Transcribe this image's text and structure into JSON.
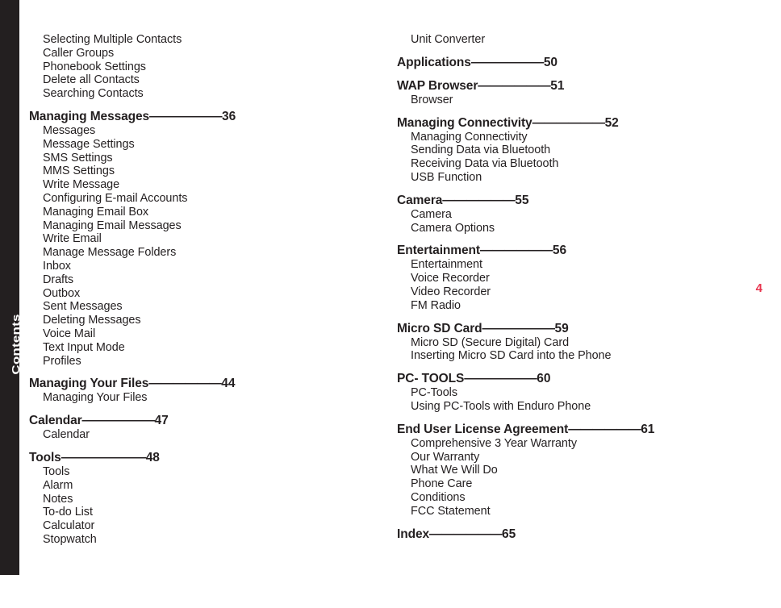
{
  "page": {
    "folio": "4",
    "folio_color": "#e8344e",
    "spine_label": "Contents",
    "spine_color": "#231f20",
    "text_color": "#231f20",
    "dash_run": "——————"
  },
  "columns": [
    {
      "id": "left",
      "blocks": [
        {
          "type": "orphan-list",
          "items": [
            "Selecting Multiple Contacts",
            "Caller Groups",
            "Phonebook Settings",
            "Delete all Contacts",
            "Searching Contacts"
          ]
        },
        {
          "type": "section",
          "title": "Managing Messages",
          "dashes": "——————",
          "page": "36",
          "items": [
            "Messages",
            "Message Settings",
            "SMS Settings",
            "MMS Settings",
            "Write Message",
            "Configuring E-mail Accounts",
            "Managing Email Box",
            "Managing Email Messages",
            "Write Email",
            "Manage Message Folders",
            "Inbox",
            "Drafts",
            "Outbox",
            "Sent Messages",
            "Deleting Messages",
            "Voice Mail",
            "Text Input Mode",
            "Profiles"
          ]
        },
        {
          "type": "section",
          "title": "Managing Your Files",
          "dashes": "——————",
          "page": "44",
          "items": [
            "Managing Your Files"
          ]
        },
        {
          "type": "section",
          "title": "Calendar",
          "dashes": "——————",
          "page": "47",
          "items": [
            "Calendar"
          ]
        },
        {
          "type": "section",
          "title": "Tools",
          "dashes": "———————",
          "page": "48",
          "items": [
            "Tools",
            "Alarm",
            "Notes",
            "To-do List",
            "Calculator",
            "Stopwatch"
          ]
        }
      ]
    },
    {
      "id": "right",
      "blocks": [
        {
          "type": "orphan-list",
          "items": [
            "Unit Converter"
          ]
        },
        {
          "type": "section",
          "title": "Applications",
          "dashes": "——————",
          "page": "50",
          "items": []
        },
        {
          "type": "section",
          "title": "WAP Browser",
          "dashes": "——————",
          "page": "51",
          "items": [
            "Browser"
          ]
        },
        {
          "type": "section",
          "title": "Managing Connectivity",
          "dashes": "——————",
          "page": "52",
          "items": [
            "Managing Connectivity",
            "Sending Data via Bluetooth",
            "Receiving Data via Bluetooth",
            "USB Function"
          ]
        },
        {
          "type": "section",
          "title": "Camera",
          "dashes": "——————",
          "page": "55",
          "items": [
            "Camera",
            "Camera Options"
          ]
        },
        {
          "type": "section",
          "title": "Entertainment",
          "dashes": "——————",
          "page": "56",
          "items": [
            "Entertainment",
            "Voice Recorder",
            "Video Recorder",
            "FM Radio"
          ]
        },
        {
          "type": "section",
          "title": "Micro SD Card",
          "dashes": "——————",
          "page": "59",
          "items": [
            "Micro SD (Secure Digital) Card",
            "Inserting Micro SD Card into the Phone"
          ]
        },
        {
          "type": "section",
          "title": "PC- TOOLS",
          "dashes": "——————",
          "page": "60",
          "items": [
            "PC-Tools",
            "Using PC-Tools with Enduro Phone"
          ]
        },
        {
          "type": "section",
          "title": "End User License Agreement",
          "dashes": "——————",
          "page": "61",
          "items": [
            "Comprehensive 3 Year Warranty",
            "Our Warranty",
            "What We Will Do",
            "Phone Care",
            "Conditions",
            "FCC Statement"
          ]
        },
        {
          "type": "section",
          "title": "Index",
          "dashes": "——————",
          "page": "65",
          "items": []
        }
      ]
    }
  ]
}
